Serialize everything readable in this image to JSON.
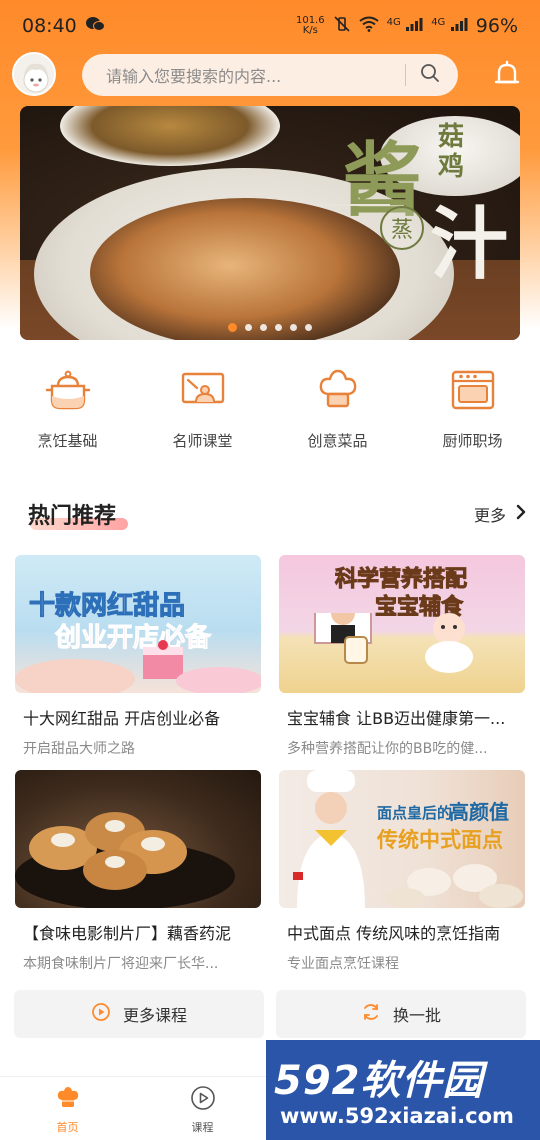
{
  "status_bar": {
    "time": "08:40",
    "speed_value": "101.6",
    "speed_unit": "K/s",
    "network_1": "4G",
    "network_2": "4G",
    "battery": "96%"
  },
  "header": {
    "search_placeholder": "请输入您要搜索的内容..."
  },
  "banner": {
    "title_main": "酱",
    "title_top_1": "菇",
    "title_top_2": "鸡",
    "title_bottom": "汁",
    "seal_text": "蒸",
    "dots_total": 6,
    "dots_active_index": 0
  },
  "categories": [
    {
      "label": "烹饪基础",
      "icon": "pot-icon"
    },
    {
      "label": "名师课堂",
      "icon": "classroom-icon"
    },
    {
      "label": "创意菜品",
      "icon": "chef-hat-icon"
    },
    {
      "label": "厨师职场",
      "icon": "oven-icon"
    }
  ],
  "recommend": {
    "title": "热门推荐",
    "more_label": "更多"
  },
  "courses": [
    {
      "title": "十大网红甜品 开店创业必备",
      "subtitle": "开启甜品大师之路",
      "thumb_text_1": "十款网红甜品",
      "thumb_text_2": "创业开店必备"
    },
    {
      "title": "宝宝辅食 让BB迈出健康第一...",
      "subtitle": "多种营养搭配让你的BB吃的健...",
      "thumb_text_1": "科学营养搭配",
      "thumb_text_2": "宝宝辅食"
    },
    {
      "title": "【食味电影制片厂】藕香药泥",
      "subtitle": "本期食味制片厂将迎来厂长华..."
    },
    {
      "title": "中式面点 传统风味的烹饪指南",
      "subtitle": "专业面点烹饪课程",
      "thumb_text_1": "面点皇后的",
      "thumb_text_1b": "高颜值",
      "thumb_text_2": "传统中式面点"
    }
  ],
  "actions": {
    "more_courses": "更多课程",
    "refresh": "换一批"
  },
  "tabbar": [
    {
      "label": "首页",
      "active": true
    },
    {
      "label": "课程",
      "active": false
    }
  ],
  "watermark": {
    "brand": "592软件园",
    "url": "www.592xiazai.com"
  },
  "colors": {
    "accent": "#ff8a2a",
    "watermark_bg": "#2a55a8"
  }
}
